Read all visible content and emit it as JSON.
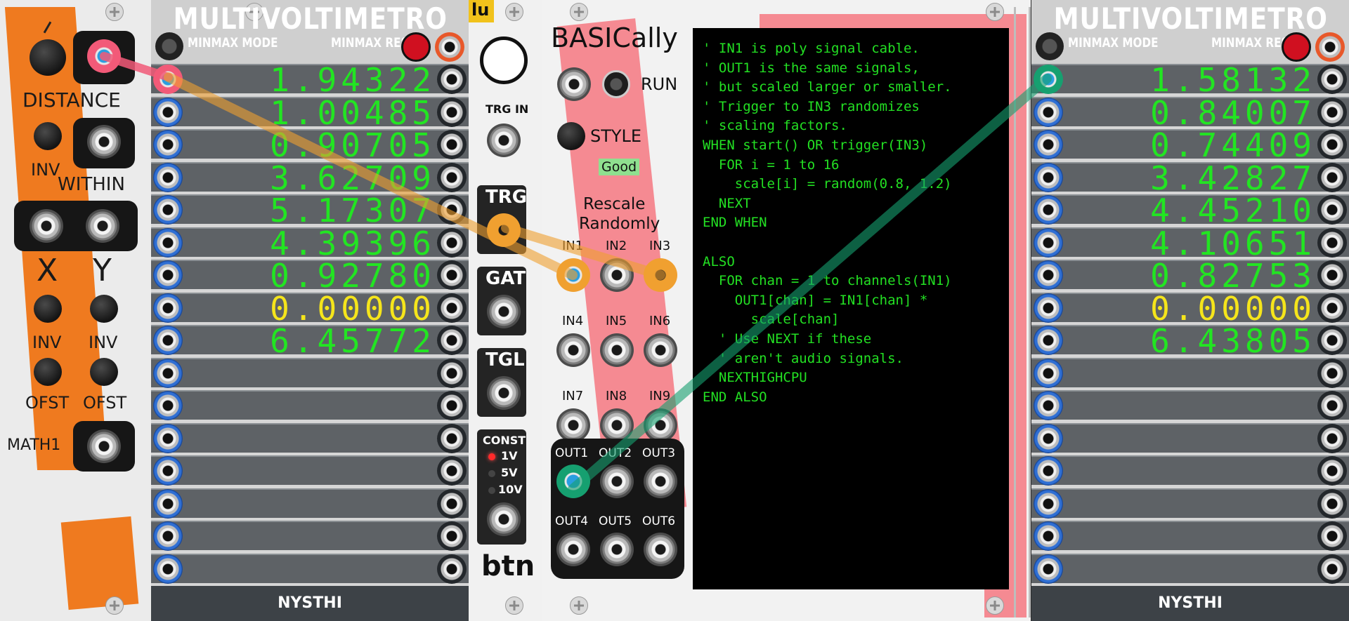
{
  "left_module": {
    "labels": {
      "distance": "DISTANCE",
      "inv": "INV",
      "within": "WITHIN",
      "x": "X",
      "y": "Y",
      "inv_x": "INV",
      "inv_y": "INV",
      "ofst_x": "OFST",
      "ofst_y": "OFST",
      "math1": "MATH1"
    }
  },
  "multivoltimetro_1": {
    "title": "MULTIVOLTIMETRO",
    "minmax_mode": "MINMAX MODE",
    "minmax_reset": "MINMAX RESET",
    "footer": "NYSTHI",
    "values": [
      "1.94322",
      "1.00485",
      "0.90705",
      "3.62709",
      "5.17307",
      "4.39396",
      "0.92780",
      "0.00000",
      "6.45772",
      "",
      "",
      "",
      "",
      "",
      "",
      ""
    ]
  },
  "btn_module": {
    "logo": "lu",
    "trg_in": "TRG IN",
    "trg": "TRG",
    "gat": "GAT",
    "tgl": "TGL",
    "const": "CONST",
    "v1": "1V",
    "v5": "5V",
    "v10": "10V",
    "name": "btn"
  },
  "basically": {
    "title": "BASICally",
    "run": "RUN",
    "style": "STYLE",
    "status": "Good",
    "rescale_1": "Rescale",
    "rescale_2": "Randomly",
    "inputs": [
      "IN1",
      "IN2",
      "IN3",
      "IN4",
      "IN5",
      "IN6",
      "IN7",
      "IN8",
      "IN9"
    ],
    "outputs": [
      "OUT1",
      "OUT2",
      "OUT3",
      "OUT4",
      "OUT5",
      "OUT6"
    ],
    "code": [
      "' IN1 is poly signal cable.",
      "' OUT1 is the same signals,",
      "' but scaled larger or smaller.",
      "' Trigger to IN3 randomizes",
      "' scaling factors.",
      "WHEN start() OR trigger(IN3)",
      "  FOR i = 1 to 16",
      "    scale[i] = random(0.8, 1.2)",
      "  NEXT",
      "END WHEN",
      "",
      "ALSO",
      "  FOR chan = 1 to channels(IN1)",
      "    OUT1[chan] = IN1[chan] *",
      "      scale[chan]",
      "  ' Use NEXT if these",
      "  ' aren't audio signals.",
      "  NEXTHIGHCPU",
      "END ALSO"
    ]
  },
  "multivoltimetro_2": {
    "title": "MULTIVOLTIMETRO",
    "minmax_mode": "MINMAX MODE",
    "minmax_reset": "MINMAX RESET",
    "footer": "NYSTHI",
    "values": [
      "1.58132",
      "0.84007",
      "0.74409",
      "3.42827",
      "4.45210",
      "4.10651",
      "0.82753",
      "0.00000",
      "6.43805",
      "",
      "",
      "",
      "",
      "",
      "",
      ""
    ]
  },
  "colors": {
    "accent_green": "#22e522",
    "accent_yellow": "#f5e51b",
    "orange": "#ef7a1f",
    "cable_orange": "#f0a030",
    "cable_green": "#16a070",
    "pink": "#f06070"
  }
}
